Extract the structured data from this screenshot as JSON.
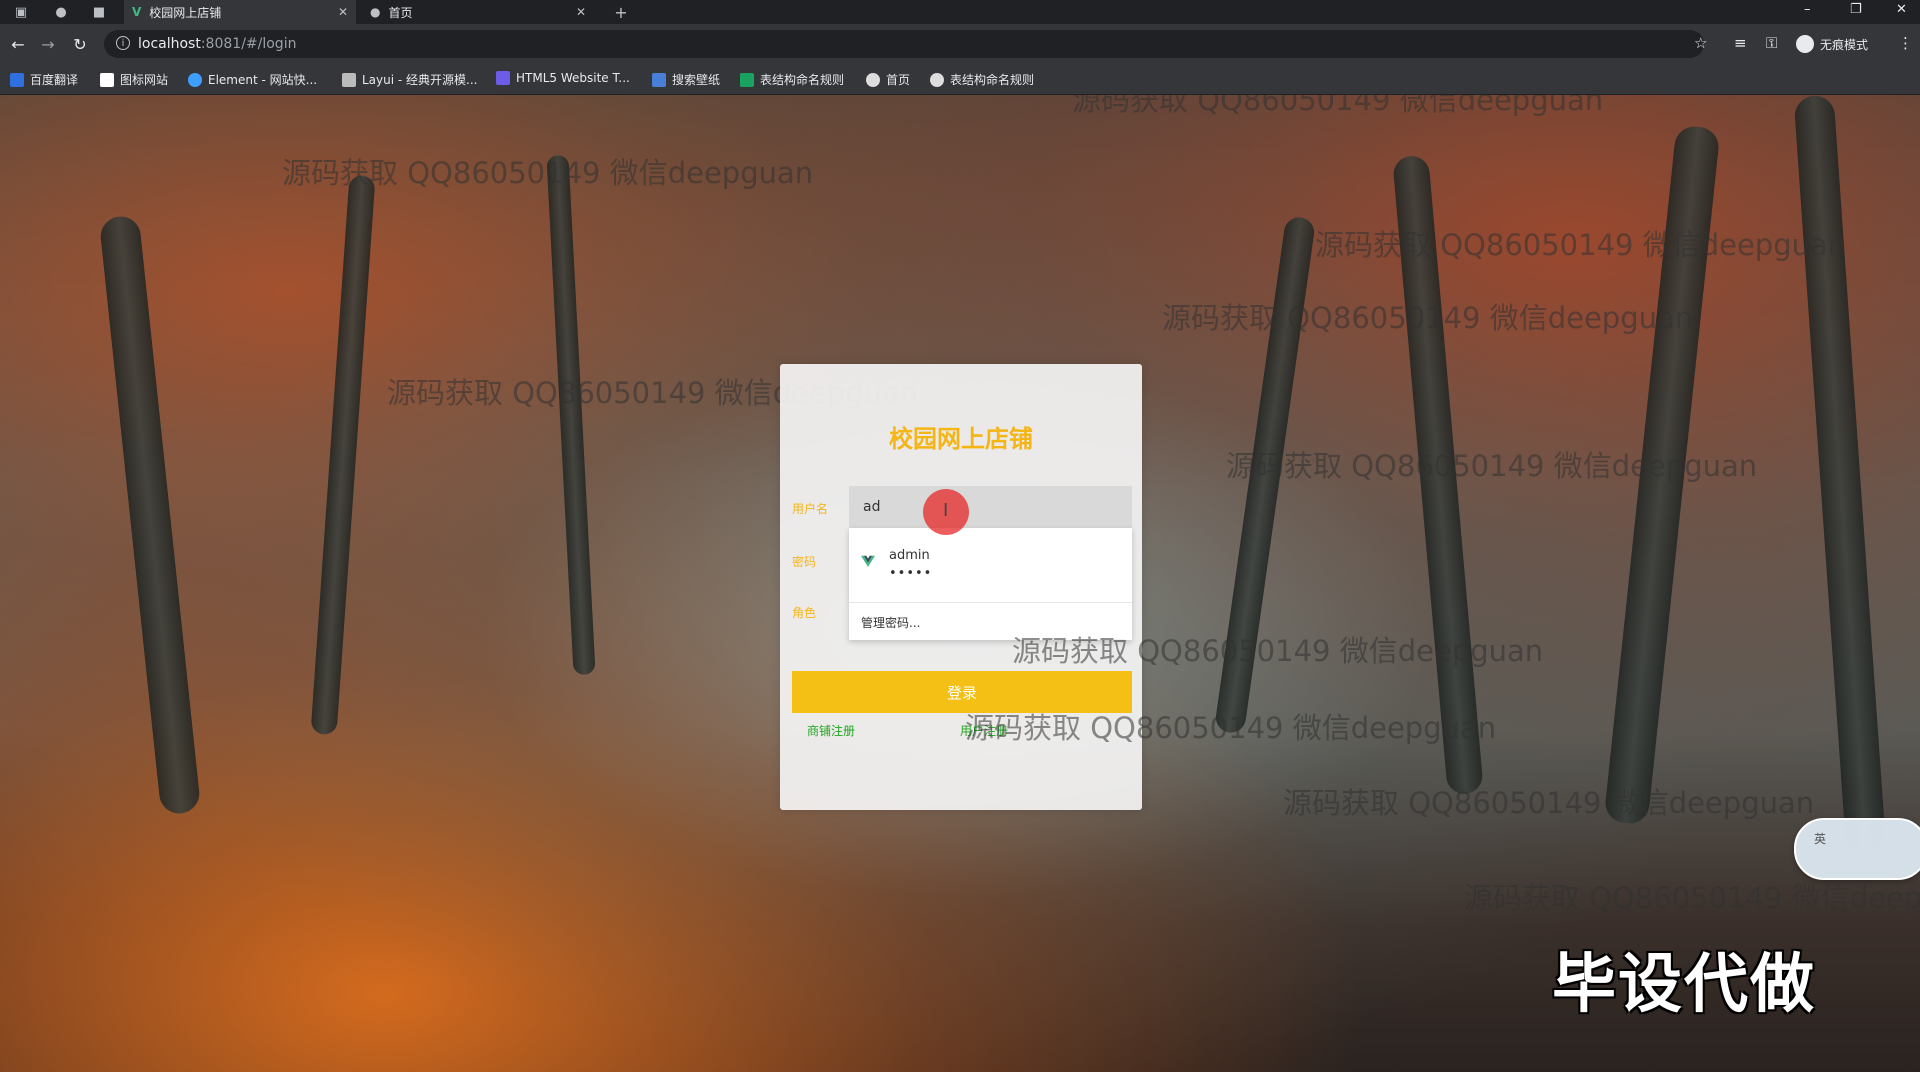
{
  "browser": {
    "tabs": [
      {
        "label": "校园网上店铺",
        "active": true
      },
      {
        "label": "首页",
        "active": false
      }
    ],
    "new_tab_symbol": "+",
    "url_host": "localhost",
    "url_path": ":8081/#/login",
    "incognito_label": "无痕模式",
    "bookmarks": [
      {
        "label": "百度翻译",
        "color": "#2f6fe0"
      },
      {
        "label": "图标网站",
        "color": "#ffffff"
      },
      {
        "label": "Element - 网站快...",
        "color": "#409eff"
      },
      {
        "label": "Layui - 经典开源模...",
        "color": "#bbbbbb"
      },
      {
        "label": "HTML5 Website T...",
        "color": "#6c5ce7"
      },
      {
        "label": "搜索壁纸",
        "color": "#4a7fd8"
      },
      {
        "label": "表结构命名规则",
        "color": "#1aa260"
      },
      {
        "label": "首页",
        "color": "#dddddd"
      },
      {
        "label": "表结构命名规则",
        "color": "#dddddd"
      }
    ]
  },
  "login": {
    "title": "校园网上店铺",
    "username_label": "用户名",
    "password_label": "密码",
    "role_label": "角色",
    "username_value": "ad",
    "login_button": "登录",
    "link_left": "商铺注册",
    "link_right": "用户注册"
  },
  "autocomplete": {
    "username": "admin",
    "password_mask": "•••••",
    "manage": "管理密码..."
  },
  "watermark_text": "源码获取 QQ86050149 微信deepguan",
  "promo_text": "毕设代做",
  "widget_text": "英",
  "colors": {
    "accent_yellow": "#f5c015",
    "title_yellow": "#f5b515",
    "link_green": "#1fa51f",
    "vue_green": "#41b883"
  }
}
